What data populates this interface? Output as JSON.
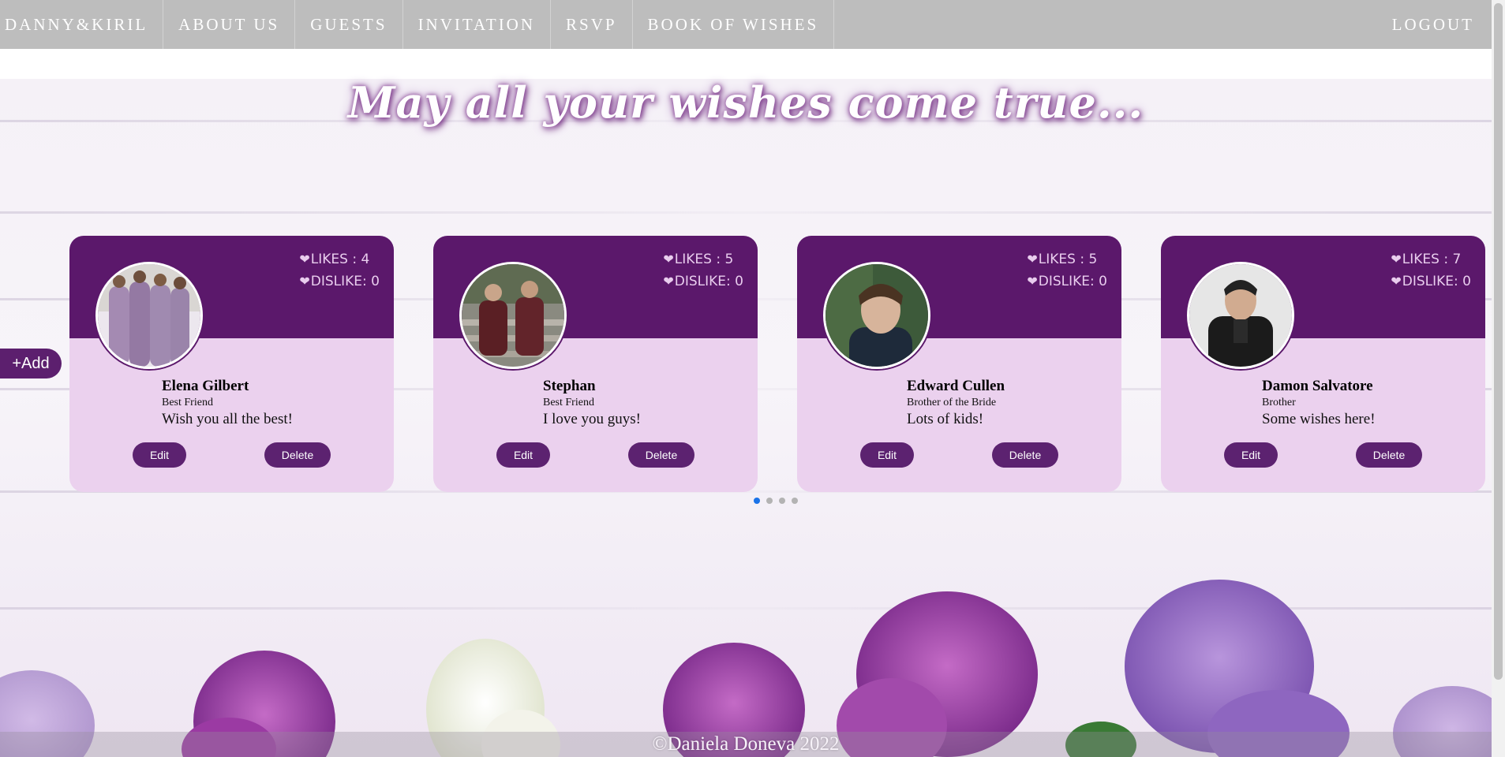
{
  "nav": {
    "brand": "DANNY&KIRIL",
    "items": [
      "ABOUT US",
      "GUESTS",
      "INVITATION",
      "RSVP",
      "BOOK OF WISHES"
    ],
    "logout": "LOGOUT"
  },
  "headline": "May all your wishes come true...",
  "add_label": "+Add",
  "cards": [
    {
      "likes": "LIKES : 4",
      "dislikes": "DISLIKE: 0",
      "name": "Elena Gilbert",
      "role": "Best Friend",
      "wish": "Wish you all the best!",
      "edit": "Edit",
      "delete": "Delete"
    },
    {
      "likes": "LIKES : 5",
      "dislikes": "DISLIKE: 0",
      "name": "Stephan",
      "role": "Best Friend",
      "wish": "I love you guys!",
      "edit": "Edit",
      "delete": "Delete"
    },
    {
      "likes": "LIKES : 5",
      "dislikes": "DISLIKE: 0",
      "name": "Edward Cullen",
      "role": "Brother of the Bride",
      "wish": "Lots of kids!",
      "edit": "Edit",
      "delete": "Delete"
    },
    {
      "likes": "LIKES : 7",
      "dislikes": "DISLIKE: 0",
      "name": "Damon Salvatore",
      "role": "Brother",
      "wish": "Some wishes here!",
      "edit": "Edit",
      "delete": "Delete"
    }
  ],
  "carousel": {
    "total_pages": 4,
    "active_page": 1
  },
  "footer": "©Daniela Doneva 2022",
  "colors": {
    "nav_bg": "#bdbdbd",
    "card_header": "#5b186b",
    "card_body": "#ebd1ee",
    "button": "#5c2270",
    "arrow": "#1a73e8"
  },
  "icons": {
    "like": "heart-icon",
    "dislike": "broken-heart-icon",
    "prev": "chevron-left-icon",
    "next": "chevron-right-icon"
  }
}
